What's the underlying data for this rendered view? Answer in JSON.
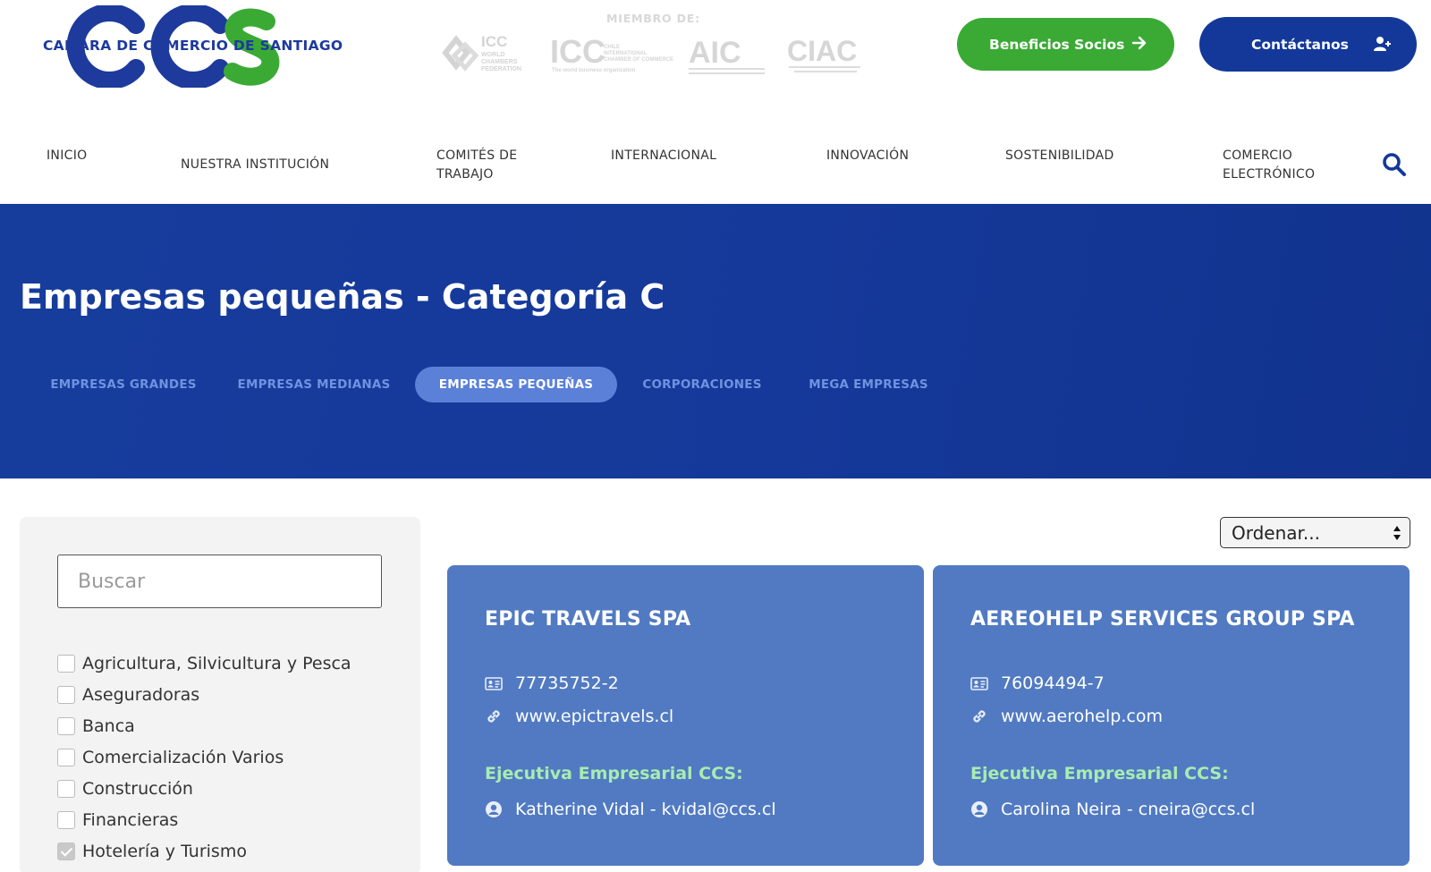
{
  "header": {
    "logo_text": "CAMARA DE COMERCIO DE SANTIAGO",
    "logo_letters": "CCS",
    "member_title": "MIEMBRO DE:",
    "member_logos": [
      {
        "text": "ICC",
        "subtitle": "WORLD CHAMBERS FEDERATION"
      },
      {
        "text": "ICC",
        "subtitle": "The world business organization"
      },
      {
        "text": "AIC",
        "subtitle": ""
      },
      {
        "text": "CIAC",
        "subtitle": ""
      }
    ],
    "benefits_button": "Beneficios Socios",
    "contact_button": "Contáctanos"
  },
  "nav": {
    "items": [
      {
        "label": "INICIO"
      },
      {
        "label": "NUESTRA INSTITUCIÓN"
      },
      {
        "label": "COMITÉS DE",
        "label2": "TRABAJO"
      },
      {
        "label": "INTERNACIONAL"
      },
      {
        "label": "INNOVACIÓN"
      },
      {
        "label": "SOSTENIBILIDAD"
      },
      {
        "label": "COMERCIO",
        "label2": "ELECTRÓNICO"
      }
    ]
  },
  "hero": {
    "title": "Empresas pequeñas - Categoría C",
    "tabs": [
      {
        "label": "EMPRESAS GRANDES",
        "active": false
      },
      {
        "label": "EMPRESAS MEDIANAS",
        "active": false
      },
      {
        "label": "EMPRESAS PEQUEÑAS",
        "active": true
      },
      {
        "label": "CORPORACIONES",
        "active": false
      },
      {
        "label": "MEGA EMPRESAS",
        "active": false
      }
    ]
  },
  "sidebar": {
    "search_placeholder": "Buscar",
    "filters": [
      {
        "label": "Agricultura, Silvicultura y Pesca",
        "checked": false
      },
      {
        "label": "Aseguradoras",
        "checked": false
      },
      {
        "label": "Banca",
        "checked": false
      },
      {
        "label": "Comercialización Varios",
        "checked": false
      },
      {
        "label": "Construcción",
        "checked": false
      },
      {
        "label": "Financieras",
        "checked": false
      },
      {
        "label": "Hotelería y Turismo",
        "checked": true
      }
    ]
  },
  "sort": {
    "selected": "Ordenar..."
  },
  "cards": [
    {
      "name": "EPIC TRAVELS SPA",
      "rut": "77735752-2",
      "website": "www.epictravels.cl",
      "exec_label": "Ejecutiva Empresarial CCS:",
      "exec": "Katherine Vidal - kvidal@ccs.cl"
    },
    {
      "name": "AEREOHELP SERVICES GROUP SPA",
      "rut": "76094494-7",
      "website": "www.aerohelp.com",
      "exec_label": "Ejecutiva Empresarial CCS:",
      "exec": "Carolina Neira - cneira@ccs.cl"
    }
  ],
  "colors": {
    "brand_blue": "#13389a",
    "brand_green": "#3aaa35",
    "hero_bg": "#163c9c",
    "tab_active": "#5a80d8",
    "card_bg": "#517ac2",
    "exec_label": "#a8ecb0"
  }
}
